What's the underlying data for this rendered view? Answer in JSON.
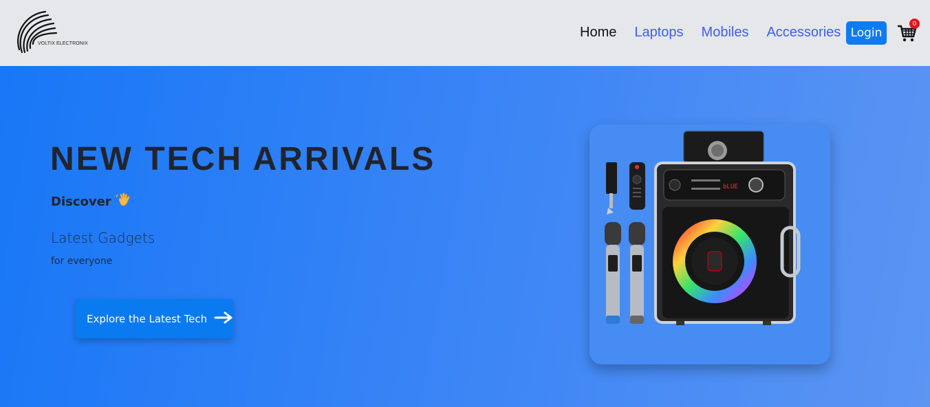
{
  "brand": {
    "name": "VOLTIX ELECTRONIX"
  },
  "nav": {
    "links": [
      {
        "label": "Home",
        "active": true
      },
      {
        "label": "Laptops",
        "active": false
      },
      {
        "label": "Mobiles",
        "active": false
      },
      {
        "label": "Accessories",
        "active": false
      }
    ],
    "login_label": "Login",
    "cart_count": "0",
    "cart_icon": "cart-icon"
  },
  "hero": {
    "title": "NEW TECH ARRIVALS",
    "discover": "Discover",
    "discover_icon": "waving-hand-icon",
    "subtitle": "Latest Gadgets",
    "tagline": "for everyone",
    "cta_label": "Explore the Latest Tech",
    "cta_icon": "arrow-right-icon",
    "product_image": "karaoke-speaker-with-microphones"
  },
  "colors": {
    "accent": "#0d7cf2",
    "hero_start": "#1877f6",
    "hero_end": "#5c95f2",
    "badge": "#e3141c",
    "nav_link": "#3d5ef0"
  }
}
